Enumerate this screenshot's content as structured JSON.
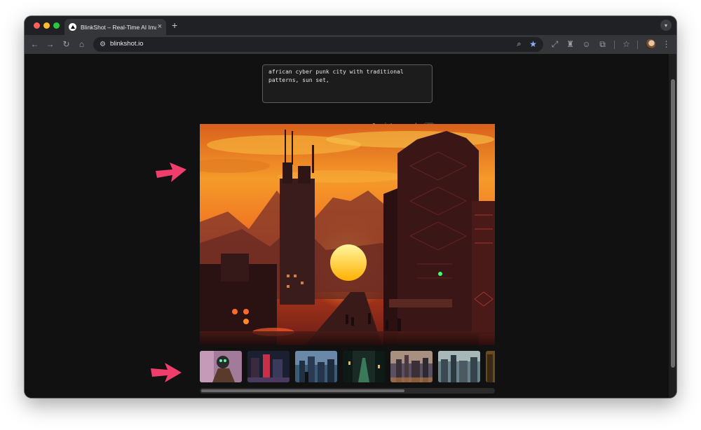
{
  "browser": {
    "tab_title": "BlinkShot – Real-Time AI Image Playground",
    "tab_close_glyph": "×",
    "new_tab_glyph": "+",
    "url": "blinkshot.io",
    "icons": [
      "back-icon",
      "forward-icon",
      "reload-icon",
      "home-icon",
      "site-settings-icon",
      "zoom-icon",
      "bookmark-star-icon",
      "expand-icon",
      "extension-icon",
      "extension-icon",
      "puzzle-icon",
      "bookmarks-icon",
      "profile-avatar",
      "menu-icon"
    ]
  },
  "app": {
    "prompt_value": "african cyber punk city with traditional patterns, sun set,",
    "consistency_label": "Consistency mode",
    "consistency_enabled": false
  },
  "gallery": {
    "thumbnails": [
      {
        "name": "thumbnail-1",
        "subject": "cyberpunk character portrait"
      },
      {
        "name": "thumbnail-2",
        "subject": "neon city street"
      },
      {
        "name": "thumbnail-3",
        "subject": "city skyline dusk"
      },
      {
        "name": "thumbnail-4",
        "subject": "green neon alley"
      },
      {
        "name": "thumbnail-5",
        "subject": "city skyline sunset"
      },
      {
        "name": "thumbnail-6",
        "subject": "futuristic city haze"
      },
      {
        "name": "thumbnail-7",
        "subject": "partially visible"
      }
    ]
  },
  "colors": {
    "annotation_arrow": "#ef3e6b",
    "bookmark_star": "#8ab4f8",
    "page_background": "#111111"
  }
}
